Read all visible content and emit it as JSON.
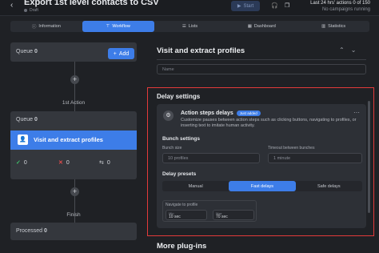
{
  "header": {
    "back_icon": "chevron-left-icon",
    "title": "Export 1st level contacts to CSV",
    "status": "Draft",
    "start_label": "Start",
    "stats_line1": "Last 24 hrs' actions 0 of 150",
    "stats_line2": "No campaigns running"
  },
  "tabs": [
    {
      "label": "Information",
      "icon": "info-icon"
    },
    {
      "label": "Workflow",
      "icon": "workflow-icon",
      "active": true
    },
    {
      "label": "Lists",
      "icon": "list-icon"
    },
    {
      "label": "Dashboard",
      "icon": "dashboard-icon"
    },
    {
      "label": "Statistics",
      "icon": "statistics-icon"
    }
  ],
  "workflow": {
    "queue_top_label": "Queue",
    "queue_top_count": "0",
    "add_label": "Add",
    "action_section": "1st Action",
    "queue_action_label": "Queue",
    "queue_action_count": "0",
    "action_name": "Visit and extract profiles",
    "success_count": "0",
    "fail_count": "0",
    "skip_count": "0",
    "finish_label": "Finish",
    "processed_label": "Processed",
    "processed_count": "0"
  },
  "panel": {
    "title": "Visit and extract profiles",
    "name_placeholder": "Name",
    "delay_settings_title": "Delay settings",
    "action_steps_title": "Action steps delays",
    "just_added_badge": "Just added",
    "action_steps_desc": "Customize pauses between action steps such as clicking buttons, navigating to profiles, or inserting text to imitate human activity.",
    "bunch_settings_title": "Bunch settings",
    "bunch_size_label": "Bunch size",
    "bunch_size_value": "10 profiles",
    "timeout_label": "Timeout between bunches",
    "timeout_value": "1 minute",
    "delay_presets_title": "Delay presets",
    "presets": [
      "Manual",
      "Fast delays",
      "Safe delays"
    ],
    "active_preset": "Fast delays",
    "navigate_label": "Navigate to profile",
    "min_label": "Min",
    "min_value": "10 sec",
    "max_label": "Max",
    "max_value": "70 sec",
    "more_plugins": "More plug-ins"
  }
}
